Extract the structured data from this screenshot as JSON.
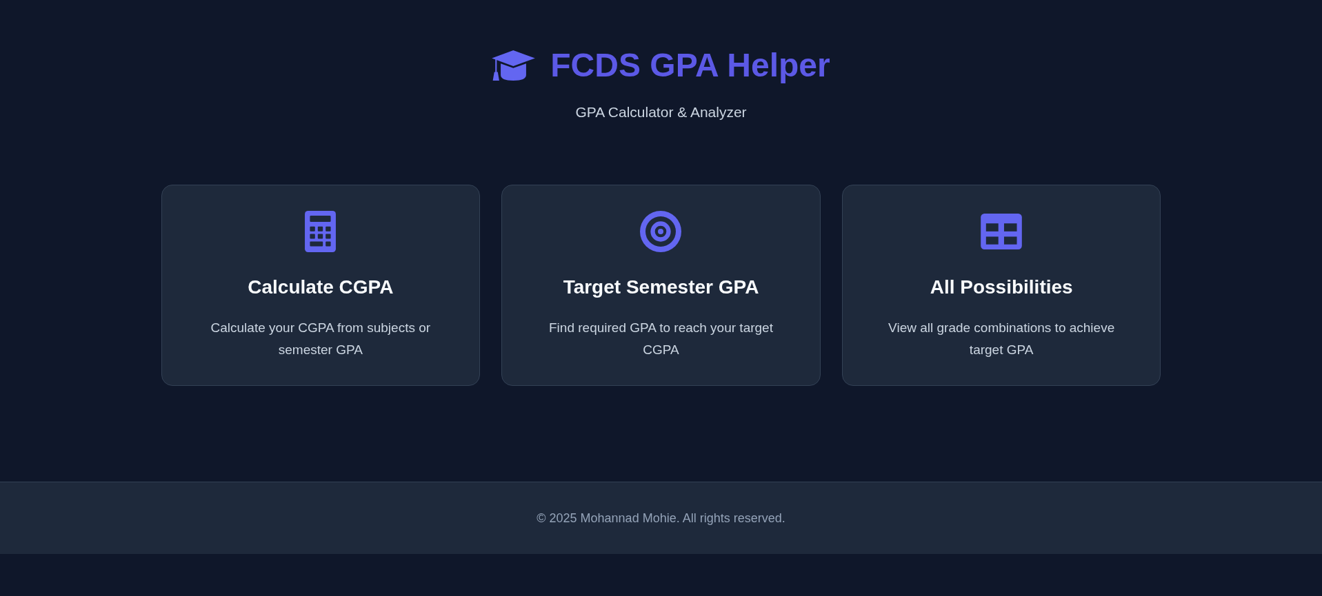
{
  "header": {
    "title": "FCDS GPA Helper",
    "subtitle": "GPA Calculator & Analyzer"
  },
  "cards": [
    {
      "kind": "calculator",
      "title": "Calculate CGPA",
      "description": "Calculate your CGPA from subjects or semester GPA"
    },
    {
      "kind": "target",
      "title": "Target Semester GPA",
      "description": "Find required GPA to reach your target CGPA"
    },
    {
      "kind": "table",
      "title": "All Possibilities",
      "description": "View all grade combinations to achieve target GPA"
    }
  ],
  "footer": {
    "text": "© 2025 Mohannad Mohie. All rights reserved."
  }
}
